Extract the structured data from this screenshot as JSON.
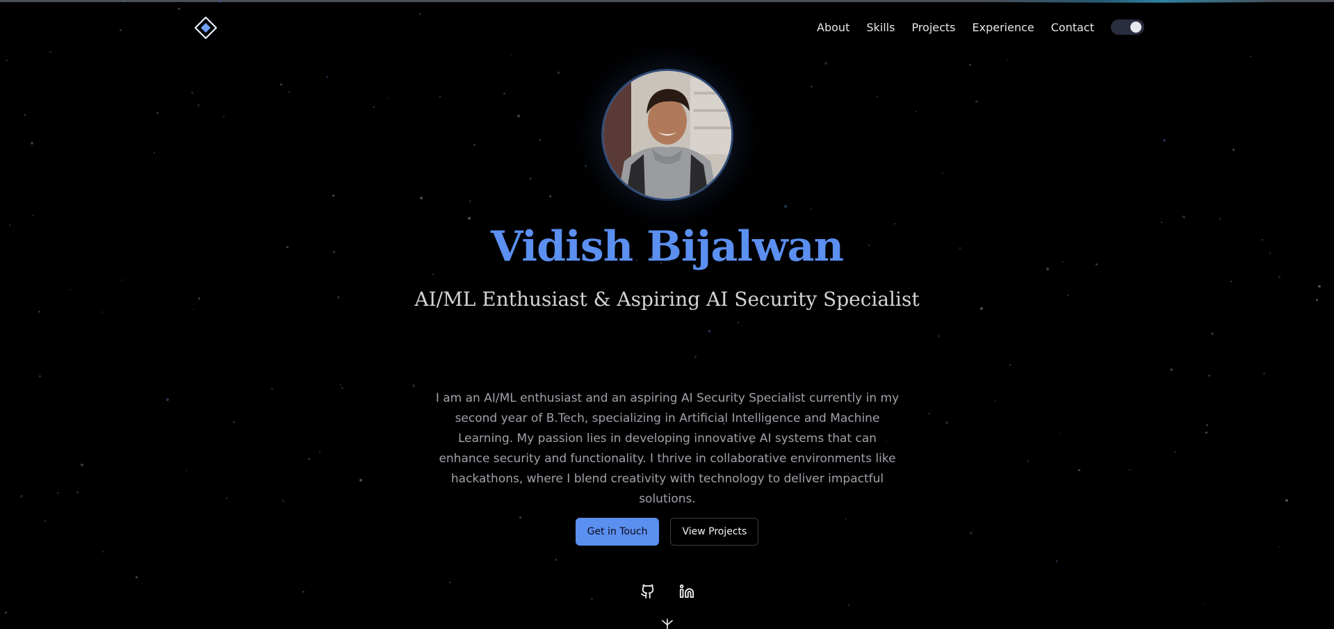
{
  "header": {
    "logo_icon": "diamond-logo-icon",
    "nav": [
      {
        "label": "About"
      },
      {
        "label": "Skills"
      },
      {
        "label": "Projects"
      },
      {
        "label": "Experience"
      },
      {
        "label": "Contact"
      }
    ],
    "theme_toggle": {
      "state": "on",
      "icon": "toggle-switch"
    }
  },
  "hero": {
    "name": "Vidish Bijalwan",
    "subtitle": "AI/ML Enthusiast & Aspiring AI Security Specialist",
    "bio": "I am an AI/ML enthusiast and an aspiring AI Security Specialist currently in my second year of B.Tech, specializing in Artificial Intelligence and Machine Learning. My passion lies in developing innovative AI systems that can enhance security and functionality. I thrive in collaborative environments like hackathons, where I blend creativity with technology to deliver impactful solutions.",
    "primary_button": "Get in Touch",
    "secondary_button": "View Projects",
    "socials": [
      {
        "icon": "github-icon"
      },
      {
        "icon": "linkedin-icon"
      }
    ]
  },
  "colors": {
    "accent": "#5b8ff0",
    "background": "#000000",
    "text": "#e5e7eb",
    "muted": "#a1a1aa"
  }
}
